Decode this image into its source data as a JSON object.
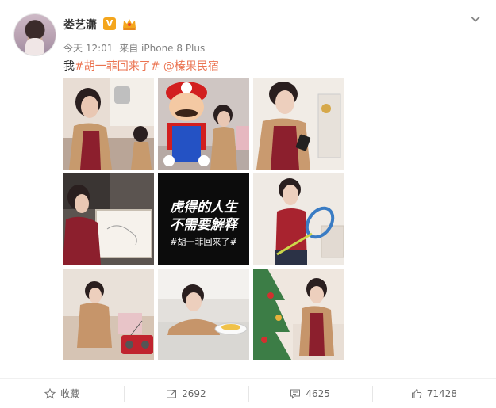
{
  "user": {
    "name": "娄艺潇",
    "verified_badge": "V"
  },
  "meta": {
    "time": "今天 12:01",
    "source": "来自 iPhone 8 Plus"
  },
  "post": {
    "prefix": "我",
    "hashtag": "#胡一菲回来了#",
    "mention": "@榛果民宿"
  },
  "grid": {
    "images": [
      {
        "name": "photo-woman-kitchen"
      },
      {
        "name": "photo-mario-mascot"
      },
      {
        "name": "photo-woman-phone"
      },
      {
        "name": "photo-woman-drawing"
      },
      {
        "name": "photo-text-card",
        "line1": "虎得的人生",
        "line2": "不需要解释",
        "tag": "#胡一菲回来了#"
      },
      {
        "name": "photo-woman-tennis"
      },
      {
        "name": "photo-woman-sofa-radio"
      },
      {
        "name": "photo-woman-table-plate"
      },
      {
        "name": "photo-woman-christmas-tree"
      }
    ]
  },
  "actions": {
    "favorite": {
      "label": "收藏",
      "icon": "star-icon"
    },
    "repost": {
      "count": "2692",
      "icon": "repost-icon"
    },
    "comment": {
      "count": "4625",
      "icon": "comment-icon"
    },
    "like": {
      "count": "71428",
      "icon": "thumbs-up-icon"
    }
  },
  "colors": {
    "link": "#eb7350",
    "badge": "#f4a61d",
    "meta": "#808080"
  }
}
